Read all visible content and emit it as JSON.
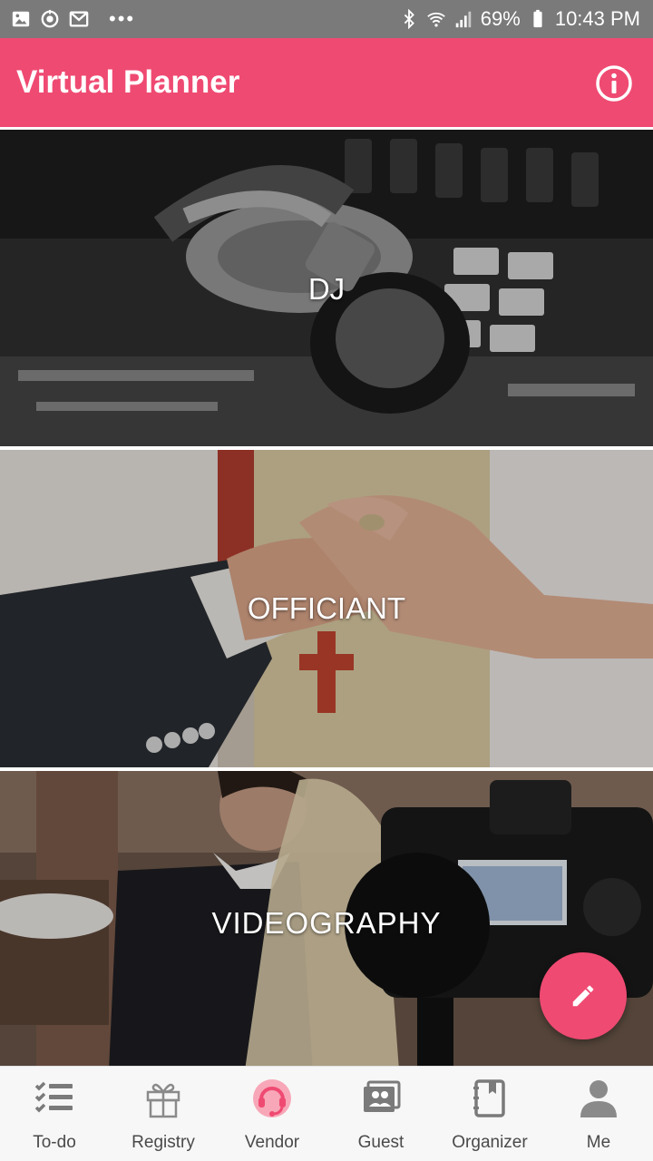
{
  "status_bar": {
    "battery": "69%",
    "time": "10:43 PM",
    "left_icons": [
      "image-icon",
      "sync-icon",
      "gmail-icon",
      "more-dots-icon"
    ],
    "right_icons": [
      "bluetooth-icon",
      "wifi-icon",
      "signal-icon",
      "battery-icon"
    ]
  },
  "app_bar": {
    "title": "Virtual Planner",
    "info_icon": "info-icon",
    "color": "#ef4a72"
  },
  "categories": [
    {
      "label": "DJ"
    },
    {
      "label": "OFFICIANT"
    },
    {
      "label": "VIDEOGRAPHY"
    }
  ],
  "fab": {
    "icon": "pencil-icon",
    "color": "#ef4a72"
  },
  "bottom_nav": {
    "items": [
      {
        "label": "To-do",
        "icon": "checklist-icon"
      },
      {
        "label": "Registry",
        "icon": "gift-icon"
      },
      {
        "label": "Vendor",
        "icon": "vendor-headset-icon",
        "active": true
      },
      {
        "label": "Guest",
        "icon": "guests-icon"
      },
      {
        "label": "Organizer",
        "icon": "organizer-book-icon"
      },
      {
        "label": "Me",
        "icon": "person-icon"
      }
    ],
    "active_color": "#ef4a72"
  }
}
